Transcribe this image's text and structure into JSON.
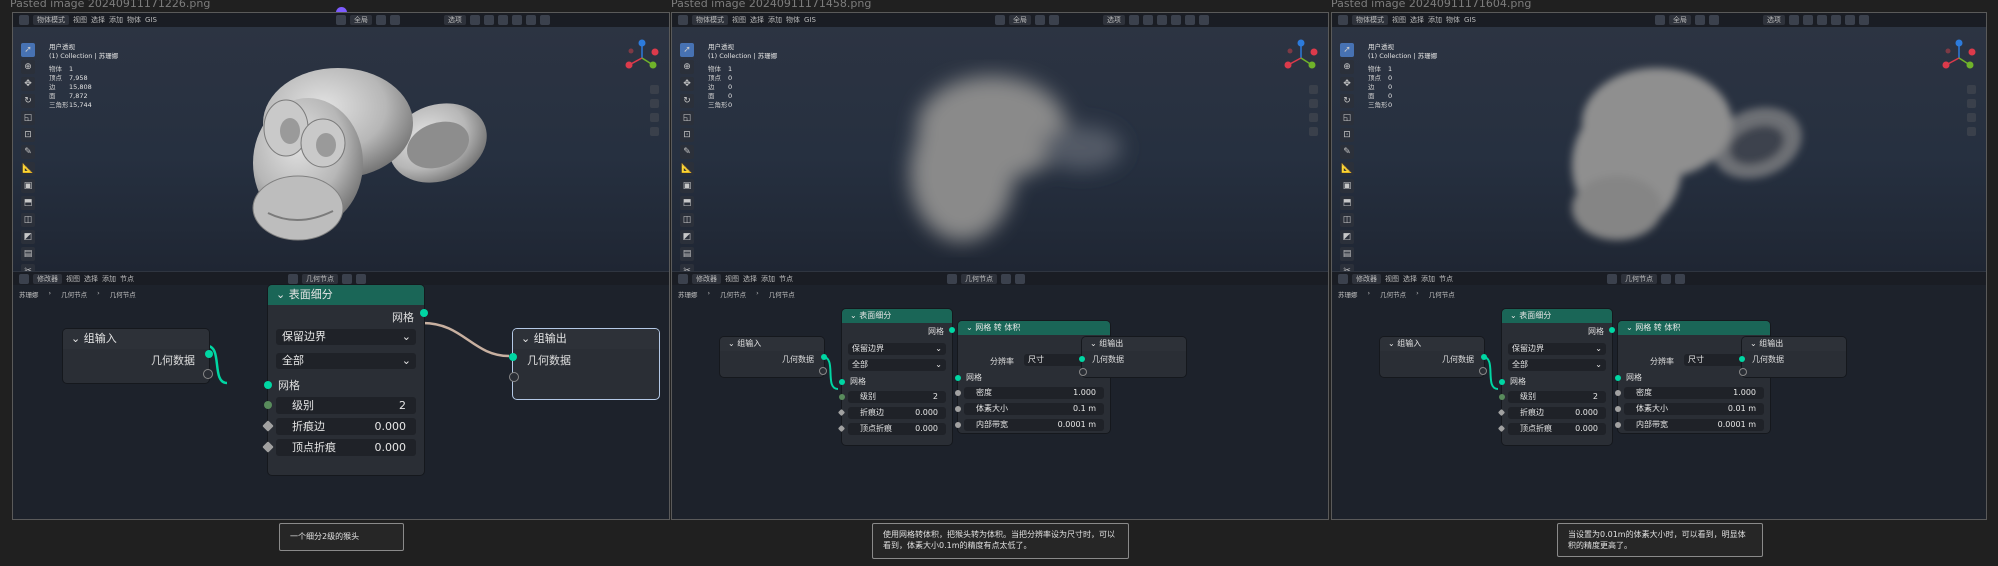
{
  "titles": [
    "Pasted image 20240911171226.png",
    "Pasted image 20240911171458.png",
    "Pasted image 20240911171604.png"
  ],
  "viewport": {
    "mode": "物体模式",
    "menus": [
      "视图",
      "选择",
      "添加",
      "物体",
      "GIS"
    ],
    "global": "全局",
    "shading": "选项",
    "view_name": "用户透视",
    "collection": "(1) Collection | 苏珊娜"
  },
  "stats": [
    [
      [
        "物体",
        "1"
      ],
      [
        "顶点",
        "7,958"
      ],
      [
        "边",
        "15,808"
      ],
      [
        "面",
        "7,872"
      ],
      [
        "三角形",
        "15,744"
      ]
    ],
    [
      [
        "物体",
        "1"
      ],
      [
        "顶点",
        "0"
      ],
      [
        "边",
        "0"
      ],
      [
        "面",
        "0"
      ],
      [
        "三角形",
        "0"
      ]
    ],
    [
      [
        "物体",
        "1"
      ],
      [
        "顶点",
        "0"
      ],
      [
        "边",
        "0"
      ],
      [
        "面",
        "0"
      ],
      [
        "三角形",
        "0"
      ]
    ]
  ],
  "node_editor": {
    "editor_type": "修改器",
    "menus": [
      "视图",
      "选择",
      "添加",
      "节点"
    ],
    "tree_name": "几何节点",
    "breadcrumb": [
      "苏珊娜",
      "几何节点",
      "几何节点"
    ]
  },
  "nodes": {
    "group_input": {
      "title": "组输入",
      "output": "几何数据"
    },
    "subdivision": {
      "title": "表面细分",
      "output": "网格",
      "uv_smooth": "保留边界",
      "boundary": "全部",
      "input": "网格",
      "level_label": "级别",
      "level_value": "2",
      "crease_label": "折痕边",
      "crease_value": "0.000",
      "vcrease_label": "顶点折痕",
      "vcrease_value": "0.000"
    },
    "mesh_to_volume": {
      "title": "网格 转 体积",
      "output": "体积",
      "res_mode_label": "分辨率",
      "res_mode_value": "尺寸",
      "input": "网格",
      "density_label": "密度",
      "density_value": "1.000",
      "voxel_label": "体素大小",
      "band_label": "内部带宽",
      "band_value": "0.0001 m"
    },
    "group_output": {
      "title": "组输出",
      "input": "几何数据"
    }
  },
  "voxel_values": [
    "0.1 m",
    "0.01 m"
  ],
  "captions": [
    "一个细分2级的猴头",
    "使用网格转体积，把猴头转为体积。当把分辨率设为尺寸时，可以看到，体素大小0.1m的精度有点太低了。",
    "当设置为0.01m的体素大小时，可以看到，明显体积的精度更高了。"
  ],
  "colors": {
    "geometry_socket": "#00d6a3",
    "float_socket": "#a1a1a1",
    "int_socket": "#598c5c",
    "node_header_green": "#1a6657",
    "accent_blue": "#4772b3"
  }
}
